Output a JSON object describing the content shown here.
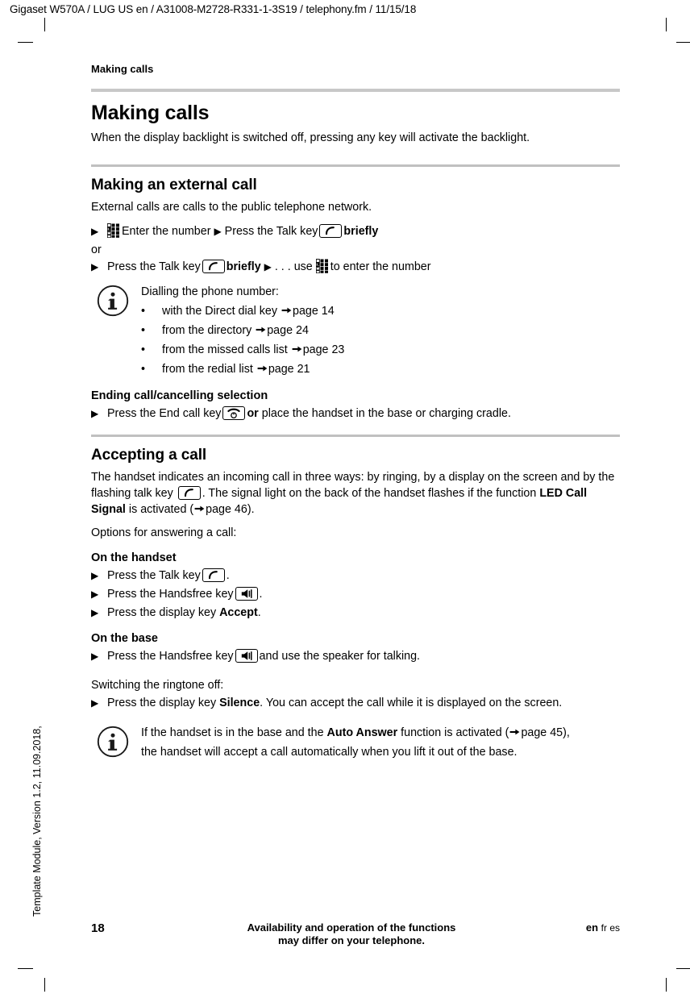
{
  "header": {
    "running_head": "Gigaset W570A / LUG US en / A31008-M2728-R331-1-3S19 / telephony.fm / 11/15/18",
    "chapter": "Making calls"
  },
  "side_note": "Template Module, Version 1.2, 11.09.2018,",
  "content": {
    "title": "Making calls",
    "intro": "When the display backlight is switched off, pressing any key will activate the backlight.",
    "section_external": {
      "heading": "Making an external call",
      "lead": "External calls are calls to the public telephone network.",
      "step1_a": "Enter the number",
      "step1_b": "Press the Talk key",
      "step1_c": "briefly",
      "or": "or",
      "step2_a": "Press the Talk key",
      "step2_b": "briefly",
      "step2_c": ". . . use",
      "step2_d": "to enter the number",
      "info": {
        "intro": "Dialling the phone number:",
        "items": [
          {
            "text": "with the Direct dial key",
            "ref": "page 14"
          },
          {
            "text": "from the directory",
            "ref": "page 24"
          },
          {
            "text": "from the missed calls list",
            "ref": "page 23"
          },
          {
            "text": "from the redial list",
            "ref": "page 21"
          }
        ]
      },
      "ending": {
        "heading": "Ending call/cancelling selection",
        "step_a": "Press the End call key",
        "step_b": "or",
        "step_c": "place the handset in the base or charging cradle."
      }
    },
    "section_accepting": {
      "heading": "Accepting a call",
      "para_a": "The handset indicates an incoming call in three ways: by ringing, by a display on the screen and by the flashing talk key",
      "para_b": ". The signal light on the back of the handset flashes if the function",
      "para_c": "LED Call Signal",
      "para_d": "is activated (",
      "para_ref": "page 46",
      "para_e": ").",
      "options_lead": "Options for answering a call:",
      "on_handset": {
        "heading": "On the handset",
        "step1_a": "Press the Talk key",
        "step1_b": ".",
        "step2_a": "Press the Handsfree key",
        "step2_b": ".",
        "step3_a": "Press the display key",
        "step3_b": "Accept",
        "step3_c": "."
      },
      "on_base": {
        "heading": "On the base",
        "step_a": "Press the Handsfree key",
        "step_b": "and use the speaker for talking."
      },
      "ringtone": {
        "lead": "Switching the ringtone off:",
        "step_a": "Press the display key",
        "step_b": "Silence",
        "step_c": ". You can accept the call while it is displayed on the screen."
      },
      "info": {
        "line1_a": "If the handset is in the base and the",
        "line1_b": "Auto Answer",
        "line1_c": "function is activated (",
        "line1_ref": "page 45",
        "line1_d": "),",
        "line2": "the handset will accept a call automatically when you lift it out of the base."
      }
    }
  },
  "footer": {
    "page_number": "18",
    "notice_line1": "Availability and operation of the functions",
    "notice_line2": "may differ on your telephone.",
    "lang_current": "en",
    "lang_others": "fr es"
  },
  "icons": {
    "keypad": "keypad-icon",
    "talk_key": "talk-key-icon",
    "end_call_key": "end-call-key-icon",
    "handsfree_key": "handsfree-key-icon",
    "info": "info-icon",
    "arrow": "arrow-right-icon",
    "step_marker": "triangle-right-icon"
  },
  "colors": {
    "rule": "#c8c8c8",
    "text": "#000000",
    "background": "#ffffff"
  }
}
